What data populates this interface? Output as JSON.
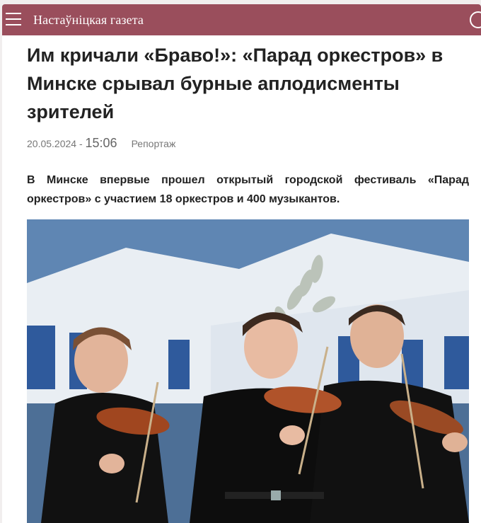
{
  "header": {
    "site_name": "Настаўніцкая газета",
    "menu_icon": "hamburger-menu-icon",
    "search_icon": "search-icon",
    "bar_color": "#9a4e5c"
  },
  "article": {
    "title": "Им кричали «Браво!»: «Парад оркестров» в Минске срывал бурные аплодисменты зрителей",
    "date": "20.05.2024 - ",
    "time": "15:06",
    "category": "Репортаж",
    "lead": "В Минске впервые прошел открытый городской фестиваль «Парад оркестров» с участием 18 оркестров и 400 музыкантов.",
    "photo_description_icon": "photo-violinists"
  }
}
